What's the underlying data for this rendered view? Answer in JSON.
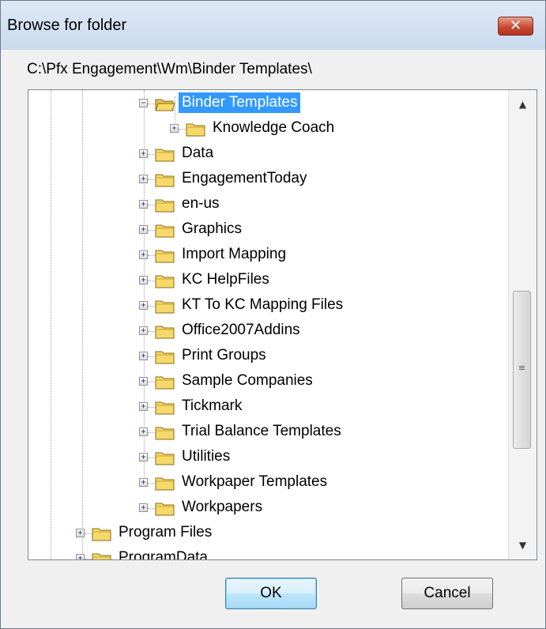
{
  "window": {
    "title": "Browse for folder",
    "close_glyph": "✕"
  },
  "path": "C:\\Pfx Engagement\\Wm\\Binder Templates\\",
  "tree": {
    "expanded_glyph": "−",
    "collapsed_glyph": "+",
    "folder_color": "#f5d96b",
    "selection_color": "#3399ff",
    "items": [
      {
        "label": "Binder Templates",
        "level": 2,
        "expanded": true,
        "selected": true
      },
      {
        "label": "Knowledge Coach",
        "level": 3,
        "expanded": false,
        "selected": false
      },
      {
        "label": "Data",
        "level": 2,
        "expanded": false,
        "selected": false
      },
      {
        "label": "EngagementToday",
        "level": 2,
        "expanded": false,
        "selected": false
      },
      {
        "label": "en-us",
        "level": 2,
        "expanded": false,
        "selected": false
      },
      {
        "label": "Graphics",
        "level": 2,
        "expanded": false,
        "selected": false
      },
      {
        "label": "Import Mapping",
        "level": 2,
        "expanded": false,
        "selected": false
      },
      {
        "label": "KC HelpFiles",
        "level": 2,
        "expanded": false,
        "selected": false
      },
      {
        "label": "KT To KC Mapping Files",
        "level": 2,
        "expanded": false,
        "selected": false
      },
      {
        "label": "Office2007Addins",
        "level": 2,
        "expanded": false,
        "selected": false
      },
      {
        "label": "Print Groups",
        "level": 2,
        "expanded": false,
        "selected": false
      },
      {
        "label": "Sample Companies",
        "level": 2,
        "expanded": false,
        "selected": false
      },
      {
        "label": "Tickmark",
        "level": 2,
        "expanded": false,
        "selected": false
      },
      {
        "label": "Trial Balance Templates",
        "level": 2,
        "expanded": false,
        "selected": false
      },
      {
        "label": "Utilities",
        "level": 2,
        "expanded": false,
        "selected": false
      },
      {
        "label": "Workpaper Templates",
        "level": 2,
        "expanded": false,
        "selected": false
      },
      {
        "label": "Workpapers",
        "level": 2,
        "expanded": false,
        "selected": false
      },
      {
        "label": "Program Files",
        "level": 0,
        "expanded": false,
        "selected": false
      },
      {
        "label": "ProgramData",
        "level": 0,
        "expanded": false,
        "selected": false
      }
    ]
  },
  "scrollbar": {
    "up_glyph": "▲",
    "down_glyph": "▼",
    "grip_glyph": "≡"
  },
  "buttons": {
    "ok": "OK",
    "cancel": "Cancel"
  }
}
